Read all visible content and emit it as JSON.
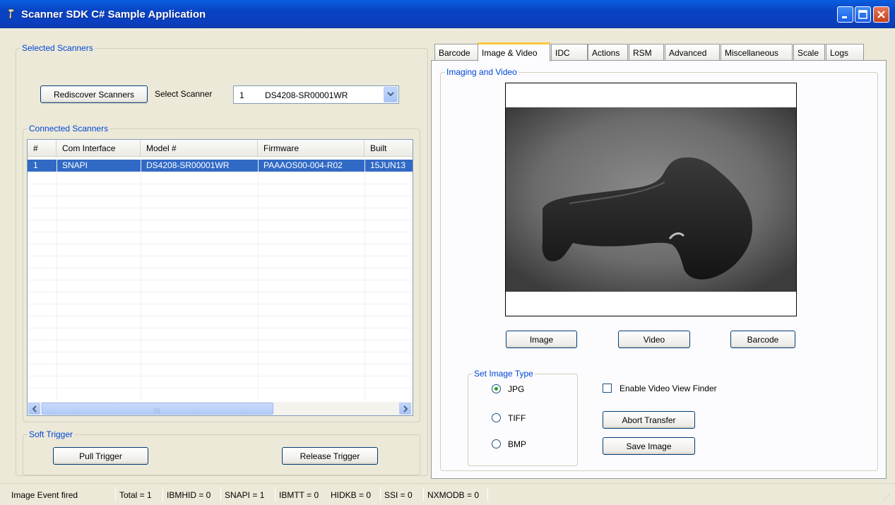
{
  "window": {
    "title": "Scanner SDK C# Sample Application"
  },
  "selected_scanners": {
    "group_title": "Selected Scanners",
    "rediscover_label": "Rediscover Scanners",
    "select_label": "Select Scanner",
    "combo_index": "1",
    "combo_value": "DS4208-SR00001WR"
  },
  "connected_scanners": {
    "group_title": "Connected Scanners",
    "columns": [
      "#",
      "Com Interface",
      "Model #",
      "Firmware",
      "Built"
    ],
    "rows": [
      [
        "1",
        "SNAPI",
        "DS4208-SR00001WR",
        "PAAAOS00-004-R02",
        "15JUN13"
      ]
    ],
    "scroll_grip": "|||"
  },
  "soft_trigger": {
    "group_title": "Soft Trigger",
    "pull_label": "Pull Trigger",
    "release_label": "Release Trigger"
  },
  "tabs": [
    {
      "label": "Barcode",
      "active": false
    },
    {
      "label": "Image & Video",
      "active": true
    },
    {
      "label": "IDC",
      "active": false
    },
    {
      "label": "Actions",
      "active": false
    },
    {
      "label": "RSM",
      "active": false
    },
    {
      "label": "Advanced",
      "active": false
    },
    {
      "label": "Miscellaneous",
      "active": false
    },
    {
      "label": "Scale",
      "active": false
    },
    {
      "label": "Logs",
      "active": false
    }
  ],
  "imaging": {
    "group_title": "Imaging and Video",
    "image_button": "Image",
    "video_button": "Video",
    "barcode_button": "Barcode",
    "image_type_title": "Set Image Type",
    "types": [
      {
        "label": "JPG",
        "selected": true
      },
      {
        "label": "TIFF",
        "selected": false
      },
      {
        "label": "BMP",
        "selected": false
      }
    ],
    "view_finder_label": "Enable Video View Finder",
    "view_finder_checked": false,
    "abort_label": "Abort Transfer",
    "save_label": "Save Image"
  },
  "status": {
    "message": "Image Event fired",
    "total": "Total = 1",
    "ibmhid": "IBMHID = 0",
    "snapi": "SNAPI = 1",
    "ibmtt": "IBMTT = 0",
    "hidkb": "HIDKB = 0",
    "ssi": "SSI = 0",
    "nxmodb": "NXMODB = 0"
  },
  "colors": {
    "title_bar": "#0843c4",
    "group_title": "#0046d5",
    "selection": "#316ac5",
    "active_tab_accent": "#ffc83c"
  }
}
